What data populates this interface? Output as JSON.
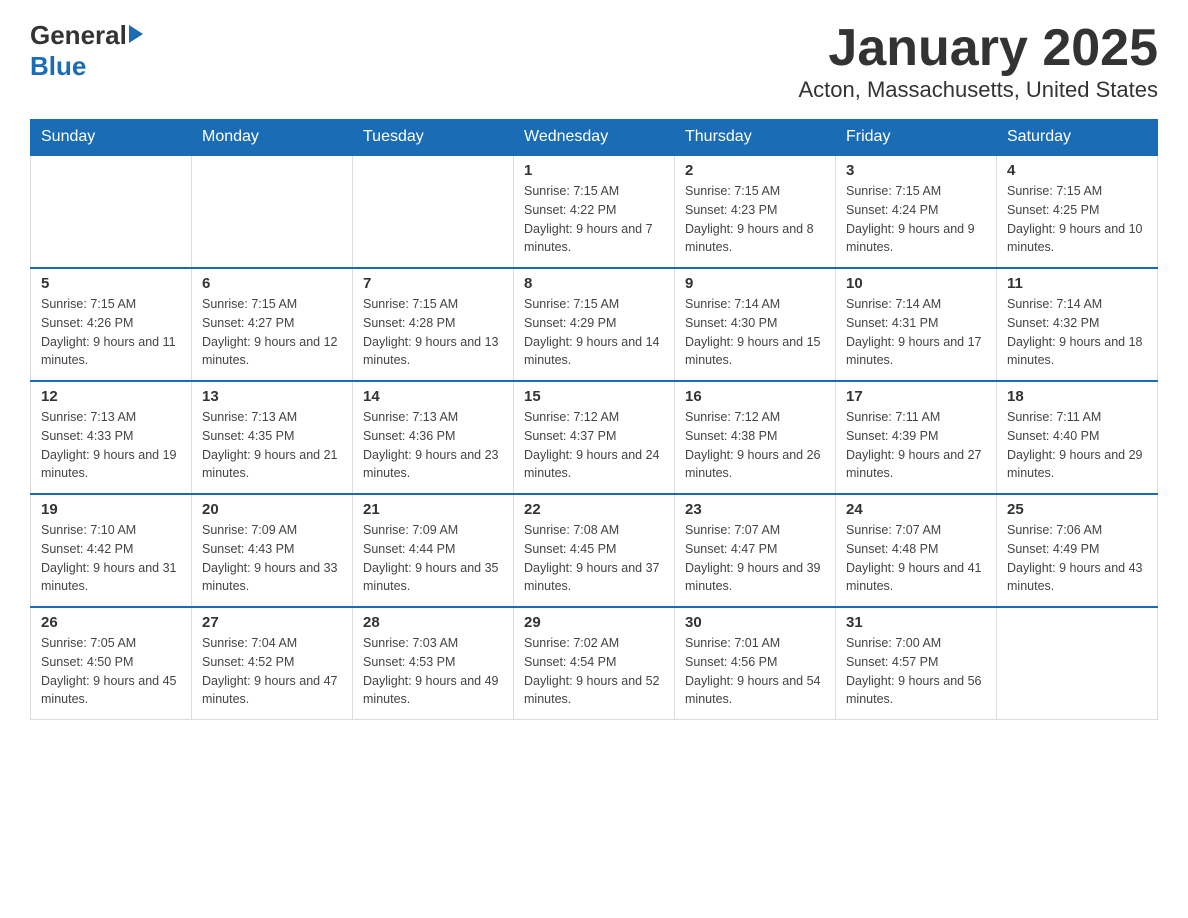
{
  "header": {
    "logo_general": "General",
    "logo_blue": "Blue",
    "month_title": "January 2025",
    "location": "Acton, Massachusetts, United States"
  },
  "days_of_week": [
    "Sunday",
    "Monday",
    "Tuesday",
    "Wednesday",
    "Thursday",
    "Friday",
    "Saturday"
  ],
  "weeks": [
    [
      {
        "day": "",
        "info": ""
      },
      {
        "day": "",
        "info": ""
      },
      {
        "day": "",
        "info": ""
      },
      {
        "day": "1",
        "info": "Sunrise: 7:15 AM\nSunset: 4:22 PM\nDaylight: 9 hours and 7 minutes."
      },
      {
        "day": "2",
        "info": "Sunrise: 7:15 AM\nSunset: 4:23 PM\nDaylight: 9 hours and 8 minutes."
      },
      {
        "day": "3",
        "info": "Sunrise: 7:15 AM\nSunset: 4:24 PM\nDaylight: 9 hours and 9 minutes."
      },
      {
        "day": "4",
        "info": "Sunrise: 7:15 AM\nSunset: 4:25 PM\nDaylight: 9 hours and 10 minutes."
      }
    ],
    [
      {
        "day": "5",
        "info": "Sunrise: 7:15 AM\nSunset: 4:26 PM\nDaylight: 9 hours and 11 minutes."
      },
      {
        "day": "6",
        "info": "Sunrise: 7:15 AM\nSunset: 4:27 PM\nDaylight: 9 hours and 12 minutes."
      },
      {
        "day": "7",
        "info": "Sunrise: 7:15 AM\nSunset: 4:28 PM\nDaylight: 9 hours and 13 minutes."
      },
      {
        "day": "8",
        "info": "Sunrise: 7:15 AM\nSunset: 4:29 PM\nDaylight: 9 hours and 14 minutes."
      },
      {
        "day": "9",
        "info": "Sunrise: 7:14 AM\nSunset: 4:30 PM\nDaylight: 9 hours and 15 minutes."
      },
      {
        "day": "10",
        "info": "Sunrise: 7:14 AM\nSunset: 4:31 PM\nDaylight: 9 hours and 17 minutes."
      },
      {
        "day": "11",
        "info": "Sunrise: 7:14 AM\nSunset: 4:32 PM\nDaylight: 9 hours and 18 minutes."
      }
    ],
    [
      {
        "day": "12",
        "info": "Sunrise: 7:13 AM\nSunset: 4:33 PM\nDaylight: 9 hours and 19 minutes."
      },
      {
        "day": "13",
        "info": "Sunrise: 7:13 AM\nSunset: 4:35 PM\nDaylight: 9 hours and 21 minutes."
      },
      {
        "day": "14",
        "info": "Sunrise: 7:13 AM\nSunset: 4:36 PM\nDaylight: 9 hours and 23 minutes."
      },
      {
        "day": "15",
        "info": "Sunrise: 7:12 AM\nSunset: 4:37 PM\nDaylight: 9 hours and 24 minutes."
      },
      {
        "day": "16",
        "info": "Sunrise: 7:12 AM\nSunset: 4:38 PM\nDaylight: 9 hours and 26 minutes."
      },
      {
        "day": "17",
        "info": "Sunrise: 7:11 AM\nSunset: 4:39 PM\nDaylight: 9 hours and 27 minutes."
      },
      {
        "day": "18",
        "info": "Sunrise: 7:11 AM\nSunset: 4:40 PM\nDaylight: 9 hours and 29 minutes."
      }
    ],
    [
      {
        "day": "19",
        "info": "Sunrise: 7:10 AM\nSunset: 4:42 PM\nDaylight: 9 hours and 31 minutes."
      },
      {
        "day": "20",
        "info": "Sunrise: 7:09 AM\nSunset: 4:43 PM\nDaylight: 9 hours and 33 minutes."
      },
      {
        "day": "21",
        "info": "Sunrise: 7:09 AM\nSunset: 4:44 PM\nDaylight: 9 hours and 35 minutes."
      },
      {
        "day": "22",
        "info": "Sunrise: 7:08 AM\nSunset: 4:45 PM\nDaylight: 9 hours and 37 minutes."
      },
      {
        "day": "23",
        "info": "Sunrise: 7:07 AM\nSunset: 4:47 PM\nDaylight: 9 hours and 39 minutes."
      },
      {
        "day": "24",
        "info": "Sunrise: 7:07 AM\nSunset: 4:48 PM\nDaylight: 9 hours and 41 minutes."
      },
      {
        "day": "25",
        "info": "Sunrise: 7:06 AM\nSunset: 4:49 PM\nDaylight: 9 hours and 43 minutes."
      }
    ],
    [
      {
        "day": "26",
        "info": "Sunrise: 7:05 AM\nSunset: 4:50 PM\nDaylight: 9 hours and 45 minutes."
      },
      {
        "day": "27",
        "info": "Sunrise: 7:04 AM\nSunset: 4:52 PM\nDaylight: 9 hours and 47 minutes."
      },
      {
        "day": "28",
        "info": "Sunrise: 7:03 AM\nSunset: 4:53 PM\nDaylight: 9 hours and 49 minutes."
      },
      {
        "day": "29",
        "info": "Sunrise: 7:02 AM\nSunset: 4:54 PM\nDaylight: 9 hours and 52 minutes."
      },
      {
        "day": "30",
        "info": "Sunrise: 7:01 AM\nSunset: 4:56 PM\nDaylight: 9 hours and 54 minutes."
      },
      {
        "day": "31",
        "info": "Sunrise: 7:00 AM\nSunset: 4:57 PM\nDaylight: 9 hours and 56 minutes."
      },
      {
        "day": "",
        "info": ""
      }
    ]
  ]
}
